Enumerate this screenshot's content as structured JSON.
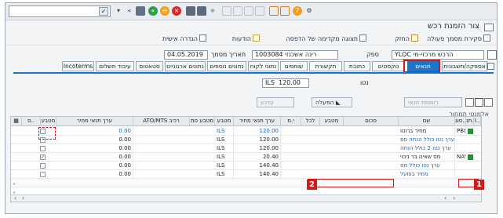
{
  "toolbar": {
    "command_placeholder": "",
    "icons": [
      "dropdown-icon",
      "nav-forward-icon",
      "save-icon",
      "back-icon",
      "exit-icon",
      "cancel-icon",
      "print-icon",
      "find-icon",
      "find-next-icon",
      "first-page-icon",
      "prev-page-icon",
      "next-page-icon",
      "last-page-icon",
      "new-session-icon",
      "shortcut-icon",
      "help-icon",
      "customize-icon"
    ]
  },
  "title": "צור הזמנת רכש",
  "appbar": {
    "personal_setting": "הגדרה אישית",
    "messages": "הודעות",
    "print_preview": "תצוגה מקדימה של הדפסה",
    "hold": "החזק",
    "other_doc": "סקירת מסמך פעולה"
  },
  "header": {
    "doc_type": "YLOC הרכש מרכזי-מי",
    "vendor_label": "ספק",
    "vendor_value": "1003084 רינה אשכנזי",
    "doc_date_label": "תאריך מסמך",
    "doc_date_value": "04.05.2019"
  },
  "tabs": [
    "אספקה/חשבונית",
    "תנאים",
    "טקסטים",
    "כתובת",
    "תקשורת",
    "שותפים",
    "נתוני לקוח",
    "נתונים נוספים",
    "נתונים ארגוניים",
    "סטאטוס",
    "עיבוד תשלום",
    "Incoterms"
  ],
  "net": {
    "label": "נטו",
    "currency": "ILS",
    "value": "120.00"
  },
  "buttons": {
    "update": "עדכון",
    "pricing": "הפעלה",
    "pricing_analysis": "רשומת תנאי",
    "items_label": "אלמנטי תמחור"
  },
  "table": {
    "headers": [
      "I..",
      "תנ..",
      "סוג..",
      "שם",
      "סכום",
      "מטבע",
      "לכל",
      "י.מ",
      "ערך תנאי מחיר",
      "מטבע",
      "מטבע סת",
      "ATO/MTS רכיב",
      "ערך תנאי מחיר",
      "מטבע",
      "ס.."
    ],
    "rows": [
      {
        "type": "PB00",
        "name": "מחיר ברוטו",
        "amount": "",
        "per": "",
        "uom": "",
        "value": "120.00",
        "curr": "ILS",
        "value2": "0.00",
        "checked": false,
        "status": "green"
      },
      {
        "type": "",
        "name": "ערך נטו כולל הנחה ספ",
        "amount": "",
        "per": "",
        "uom": "",
        "value": "120.00",
        "curr": "ILS",
        "value2": "0.00",
        "checked": false,
        "status": ""
      },
      {
        "type": "",
        "name": "ערך נטו 2 כולל הנחה",
        "amount": "",
        "per": "",
        "uom": "",
        "value": "120.00",
        "curr": "ILS",
        "value2": "0.00",
        "checked": false,
        "status": ""
      },
      {
        "type": "NAVS",
        "name": "מס שאינו בר ניכוי",
        "amount": "",
        "per": "",
        "uom": "",
        "value": "20.40",
        "curr": "ILS",
        "value2": "0.00",
        "checked": true,
        "status": "green"
      },
      {
        "type": "",
        "name": "ערך נטו כולל מס",
        "amount": "",
        "per": "",
        "uom": "",
        "value": "140.40",
        "curr": "ILS",
        "value2": "0.00",
        "checked": false,
        "status": ""
      },
      {
        "type": "",
        "name": "מחיר בפועל",
        "amount": "",
        "per": "",
        "uom": "",
        "value": "140.40",
        "curr": "ILS",
        "value2": "0.00",
        "checked": false,
        "status": ""
      },
      {
        "type": "",
        "name": "",
        "amount": "",
        "per": "",
        "uom": "",
        "value": "",
        "curr": "",
        "value2": "",
        "checked": false,
        "status": "empty"
      }
    ]
  },
  "annotations": {
    "badge_1": "1",
    "badge_2": "2"
  },
  "colors": {
    "accent": "#1e74c8",
    "highlight": "#d11b1b"
  }
}
